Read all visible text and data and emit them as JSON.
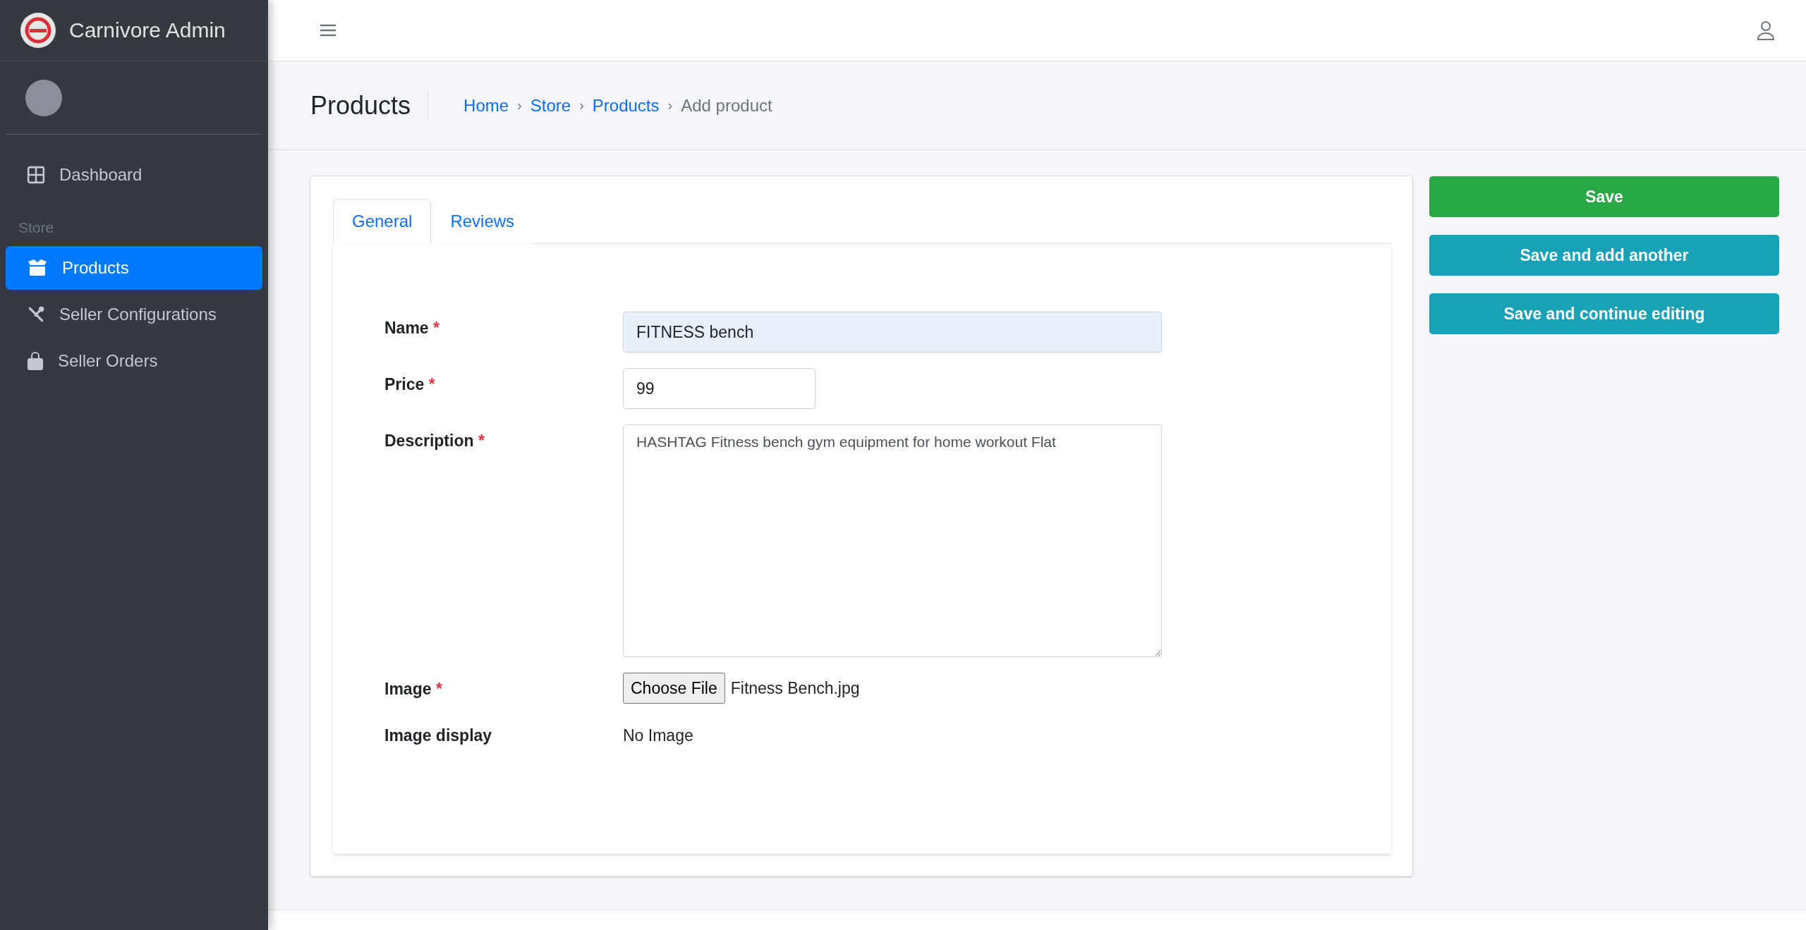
{
  "brand": {
    "title": "Carnivore Admin"
  },
  "sidebar": {
    "items": [
      {
        "label": "Dashboard",
        "selected": false
      }
    ],
    "sections": [
      {
        "title": "Store",
        "items": [
          {
            "label": "Products",
            "selected": true
          },
          {
            "label": "Seller Configurations",
            "selected": false
          },
          {
            "label": "Seller Orders",
            "selected": false
          }
        ]
      }
    ]
  },
  "content_header": {
    "title": "Products",
    "separator": "›",
    "breadcrumb": [
      {
        "label": "Home",
        "link": true
      },
      {
        "label": "Store",
        "link": true
      },
      {
        "label": "Products",
        "link": true
      },
      {
        "label": "Add product",
        "link": false
      }
    ]
  },
  "tabs": [
    {
      "label": "General",
      "selected": true
    },
    {
      "label": "Reviews",
      "selected": false
    }
  ],
  "form": {
    "fields": [
      {
        "kind": "text",
        "label": "Name",
        "required_mark": "*",
        "value": "FITNESS bench",
        "autofilled": true
      },
      {
        "kind": "number",
        "label": "Price",
        "required_mark": "*",
        "value": "99",
        "autofilled": false
      },
      {
        "kind": "textarea",
        "label": "Description",
        "required_mark": "*",
        "value": "HASHTAG Fitness bench gym equipment for home workout Flat"
      },
      {
        "kind": "file",
        "label": "Image",
        "required_mark": "*",
        "button": "Choose File",
        "value": "Fitness Bench.jpg"
      },
      {
        "kind": "static",
        "label": "Image display",
        "value": "No Image"
      }
    ]
  },
  "actions": [
    {
      "kind": "success",
      "label": "Save"
    },
    {
      "kind": "info",
      "label": "Save and add another"
    },
    {
      "kind": "info",
      "label": "Save and continue editing"
    }
  ]
}
